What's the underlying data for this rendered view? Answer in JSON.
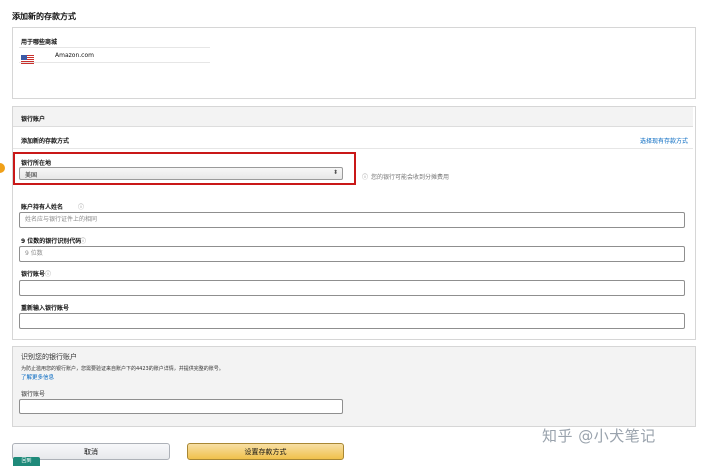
{
  "page": {
    "title": "添加新的存款方式"
  },
  "marketplace_section": {
    "label": "用于哪些商城",
    "marketplace_name": "Amazon.com",
    "flag_icon": "us-flag-icon"
  },
  "bank_section": {
    "header": "银行账户",
    "subheader": "添加新的存款方式",
    "select_existing_link": "选择现有存款方式",
    "bank_location_label": "银行所在地",
    "bank_location_value": "美国",
    "bank_location_hint": "您的银行可能会收到分摊费用",
    "account_holder_label": "账户持有人姓名",
    "account_holder_placeholder": "姓名应与银行证件上的相同",
    "routing_label": "9 位数的银行识别代码",
    "routing_placeholder": "9 位数",
    "account_number_label": "银行账号",
    "confirm_account_label": "重新输入银行账号",
    "info_glyph": "ⓘ"
  },
  "identify_section": {
    "title": "识别您的银行账户",
    "description": "为防止滥用您的银行账户，您需要验证来自账户下的4423的账户详情，并提供完整的账号。",
    "learn_more_link": "了解更多信息",
    "account_number_label": "银行账号"
  },
  "actions": {
    "cancel_label": "取消",
    "submit_label": "设置存款方式"
  },
  "overlays": {
    "watermark": "知乎 @小犬笔记",
    "corner_badge": "回到"
  },
  "colors": {
    "highlight_box": "#c91818",
    "orange_dot": "#f0a018",
    "link": "#0066c0",
    "primary_button": "#f3d078",
    "badge": "#1f8a7a"
  }
}
